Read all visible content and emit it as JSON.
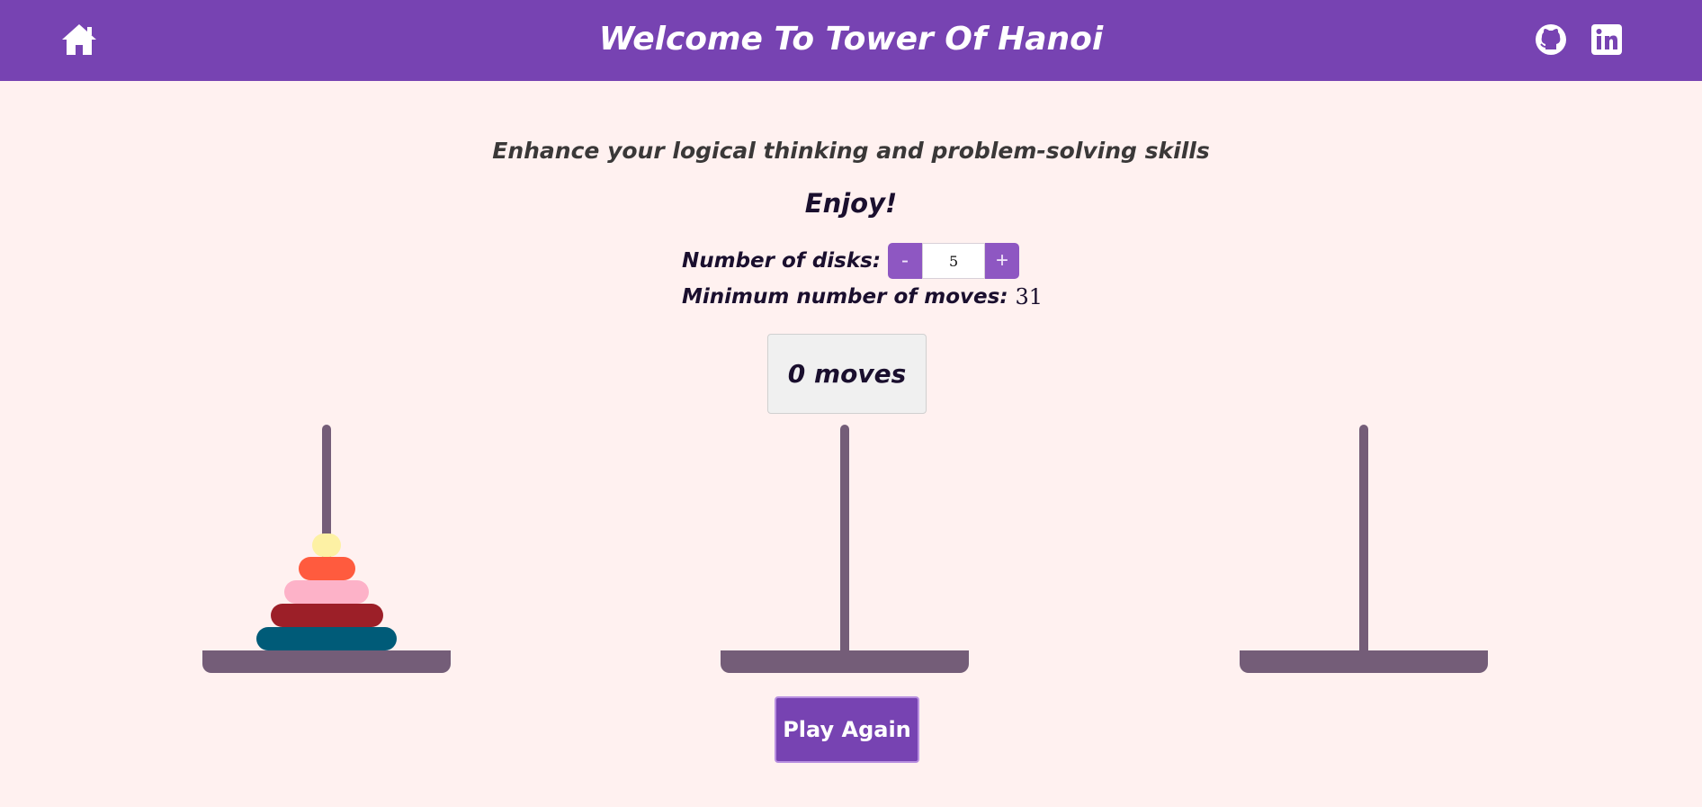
{
  "header": {
    "title": "Welcome To Tower Of Hanoi",
    "home_icon": "home-icon",
    "github_icon": "github-icon",
    "linkedin_icon": "linkedin-icon",
    "bar_color": "#7743b2"
  },
  "intro": {
    "subtitle": "Enhance your logical thinking and problem-solving skills",
    "enjoy": "Enjoy!"
  },
  "controls": {
    "disks_label": "Number of disks:",
    "minus_label": "-",
    "plus_label": "+",
    "disks_value": "5",
    "min_moves_label": "Minimum number of moves:",
    "min_moves_value": "31"
  },
  "game": {
    "moves_text": "0 moves",
    "play_again_label": "Play Again",
    "pole_color": "#745d78",
    "towers": [
      {
        "name": "tower-1",
        "disks": [
          5,
          4,
          3,
          2,
          1
        ]
      },
      {
        "name": "tower-2",
        "disks": []
      },
      {
        "name": "tower-3",
        "disks": []
      }
    ],
    "disk_colors": {
      "1": "#fdf1a4",
      "2": "#ff5b3e",
      "3": "#fdb2c8",
      "4": "#9c1f28",
      "5": "#005b78"
    }
  }
}
